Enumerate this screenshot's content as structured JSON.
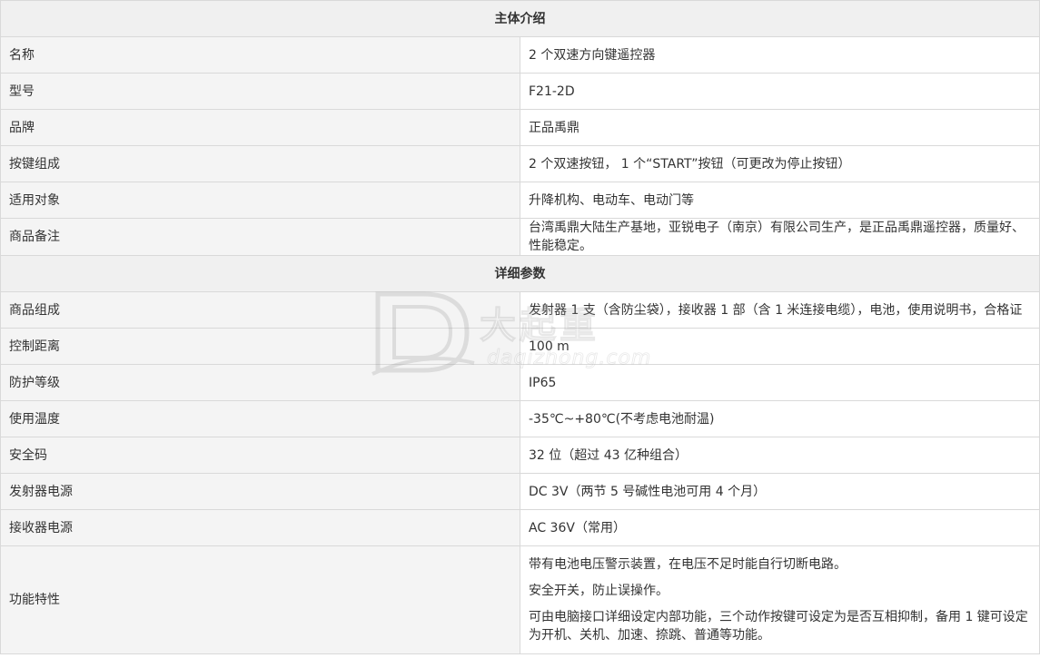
{
  "sections": {
    "intro_title": "主体介绍",
    "detail_title": "详细参数"
  },
  "intro": [
    {
      "label": "名称",
      "value": "2 个双速方向键遥控器"
    },
    {
      "label": "型号",
      "value": "F21-2D"
    },
    {
      "label": "品牌",
      "value": "正品禹鼎"
    },
    {
      "label": "按键组成",
      "value": "2 个双速按钮， 1 个“START”按钮（可更改为停止按钮）"
    },
    {
      "label": "适用对象",
      "value": "升降机构、电动车、电动门等"
    },
    {
      "label": "商品备注",
      "value": "台湾禹鼎大陆生产基地，亚锐电子（南京）有限公司生产，是正品禹鼎遥控器，质量好、性能稳定。"
    }
  ],
  "details": [
    {
      "label": "商品组成",
      "value": "发射器 1 支（含防尘袋），接收器 1 部（含 1 米连接电缆），电池，使用说明书，合格证"
    },
    {
      "label": "控制距离",
      "value": "100 m"
    },
    {
      "label": "防护等级",
      "value": "IP65"
    },
    {
      "label": "使用温度",
      "value": "-35℃~+80℃(不考虑电池耐温)"
    },
    {
      "label": "安全码",
      "value": "32 位（超过 43 亿种组合）"
    },
    {
      "label": "发射器电源",
      "value": "DC 3V（两节 5 号碱性电池可用 4 个月）"
    },
    {
      "label": "接收器电源",
      "value": "AC 36V（常用）"
    }
  ],
  "features": {
    "label": "功能特性",
    "lines": [
      "带有电池电压警示装置，在电压不足时能自行切断电路。",
      "安全开关，防止误操作。",
      "可由电脑接口详细设定内部功能，三个动作按键可设定为是否互相抑制，备用 1 键可设定为开机、关机、加速、捺跳、普通等功能。"
    ]
  },
  "watermark": {
    "title": "大起重",
    "domain": "daqizhong.com"
  }
}
